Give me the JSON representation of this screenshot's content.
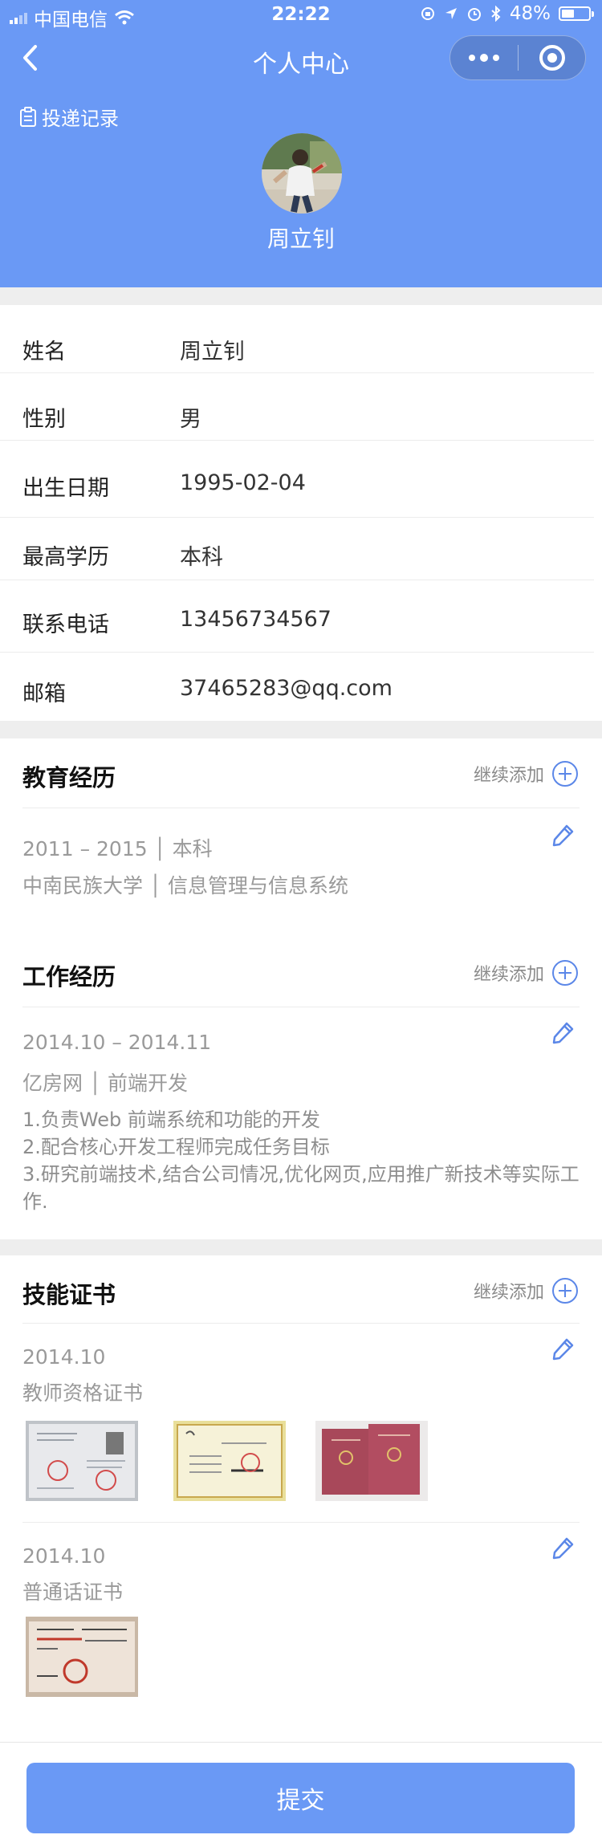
{
  "status_bar": {
    "carrier": "中国电信",
    "time": "22:22",
    "battery": "48%",
    "battery_level": 0.48
  },
  "navbar": {
    "title": "个人中心"
  },
  "header": {
    "record_link": "投递记录",
    "name": "周立钊"
  },
  "info": [
    {
      "label": "姓名",
      "value": "周立钊"
    },
    {
      "label": "性别",
      "value": "男"
    },
    {
      "label": "出生日期",
      "value": "1995-02-04"
    },
    {
      "label": "最高学历",
      "value": "本科"
    },
    {
      "label": "联系电话",
      "value": "13456734567"
    },
    {
      "label": "邮箱",
      "value": "37465283@qq.com"
    }
  ],
  "education": {
    "title": "教育经历",
    "add_label": "继续添加",
    "entries": [
      {
        "period": "2011 – 2015 │ 本科",
        "school": "中南民族大学 │ 信息管理与信息系统"
      }
    ]
  },
  "work": {
    "title": "工作经历",
    "add_label": "继续添加",
    "entries": [
      {
        "period": "2014.10 – 2014.11",
        "company": "亿房网 │ 前端开发",
        "duties": [
          "1.负责Web 前端系统和功能的开发",
          "2.配合核心开发工程师完成任务目标",
          "3.研究前端技术,结合公司情况,优化网页,应用推广新技术等实际工作."
        ]
      }
    ]
  },
  "certificates": {
    "title": "技能证书",
    "add_label": "继续添加",
    "entries": [
      {
        "date": "2014.10",
        "name": "教师资格证书"
      },
      {
        "date": "2014.10",
        "name": "普通话证书"
      }
    ]
  },
  "submit_label": "提交",
  "colors": {
    "primary": "#6a99f5",
    "accent": "#5b87e8"
  }
}
